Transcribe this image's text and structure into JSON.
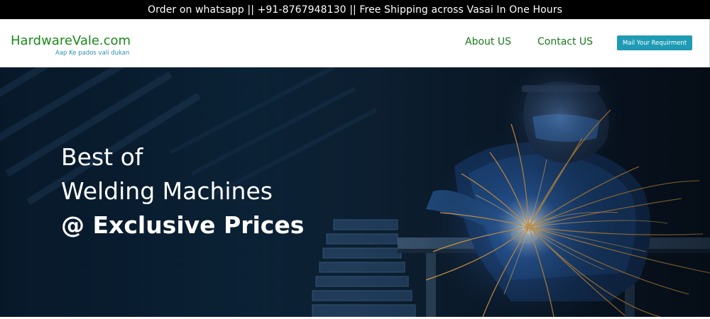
{
  "topbar": {
    "text": "Order on whatsapp || +91-8767948130 || Free Shipping across Vasai In One Hours"
  },
  "navbar": {
    "brand": "HardwareVale.com",
    "tagline": "Aap Ke pados vali dukan",
    "links": [
      {
        "label": "About US"
      },
      {
        "label": "Contact US"
      }
    ],
    "cta": "Mail Your Requirment"
  },
  "hero": {
    "lines": [
      "Best of",
      "Welding Machines",
      "@ Exclusive Prices"
    ],
    "image": "welder-with-sparks-illustration"
  }
}
